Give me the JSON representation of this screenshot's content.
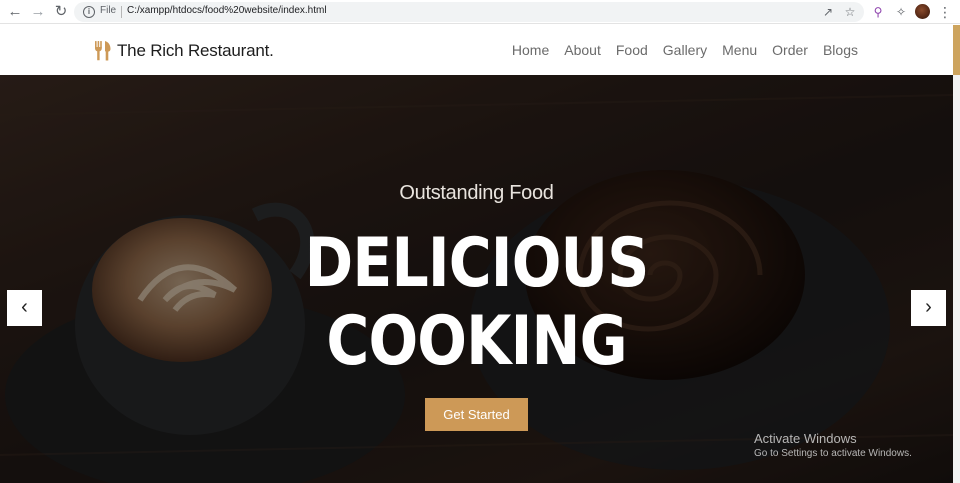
{
  "browser": {
    "scheme_label": "File",
    "url": "C:/xampp/htdocs/food%20website/index.html",
    "icons": [
      "back-arrow-icon",
      "forward-arrow-icon",
      "reload-icon",
      "info-icon",
      "share-icon",
      "star-icon",
      "search-extension-icon",
      "puzzle-icon",
      "profile-avatar",
      "more-menu-icon"
    ]
  },
  "site": {
    "logo_text": "The Rich Restaurant.",
    "logo_icon": "fork-knife-icon",
    "nav": [
      "Home",
      "About",
      "Food",
      "Gallery",
      "Menu",
      "Order",
      "Blogs"
    ]
  },
  "hero": {
    "subtitle": "Outstanding Food",
    "title_line1": "DELICIOUS",
    "title_line2": "COOKING",
    "cta_label": "Get Started",
    "prev_arrow": "‹",
    "next_arrow": "›"
  },
  "watermark": {
    "title": "Activate Windows",
    "subtitle": "Go to Settings to activate Windows."
  },
  "colors": {
    "accent": "#cd9957",
    "hero_text": "#ffffff",
    "nav_text": "#6b6b6b"
  }
}
